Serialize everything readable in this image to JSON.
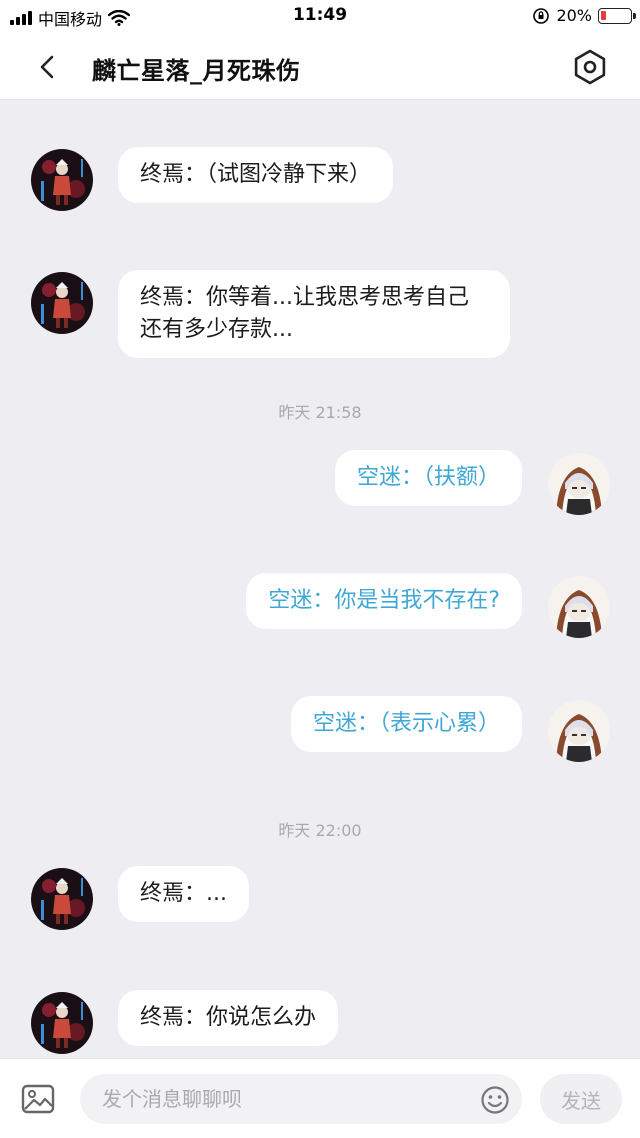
{
  "status_bar": {
    "carrier": "中国移动",
    "time": "11:49",
    "battery_percent": "20%",
    "battery_level": 0.2,
    "battery_color": "#e63b3b"
  },
  "header": {
    "title": "麟亡星落_月死珠伤",
    "back_icon": "chevron-left-icon",
    "settings_icon": "hexagon-settings-icon"
  },
  "messages": [
    {
      "side": "in",
      "text": "终焉：（试图冷静下来）"
    },
    {
      "side": "in",
      "text": "终焉：你等着...让我思考思考自己还有多少存款..."
    },
    {
      "timestamp": "昨天 21:58"
    },
    {
      "side": "out",
      "text": "空迷：（扶额）"
    },
    {
      "side": "out",
      "text": "空迷：你是当我不存在?"
    },
    {
      "side": "out",
      "text": "空迷：（表示心累）"
    },
    {
      "timestamp": "昨天 22:00"
    },
    {
      "side": "in",
      "text": "终焉：..."
    },
    {
      "side": "in",
      "text": "终焉：你说怎么办"
    }
  ],
  "input_bar": {
    "placeholder": "发个消息聊聊呗",
    "send_label": "发送",
    "image_icon": "image-icon",
    "emoji_icon": "emoji-icon"
  },
  "colors": {
    "outgoing_text": "#3fa7d6",
    "incoming_text": "#1b1b1b",
    "chat_background": "#eeeef2"
  }
}
